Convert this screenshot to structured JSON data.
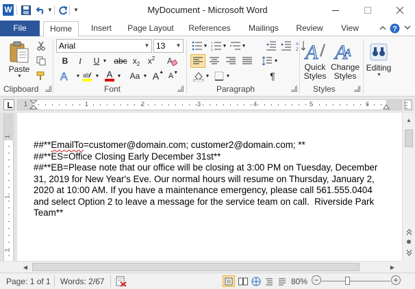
{
  "title": {
    "app_title": "MyDocument  -  Microsoft Word",
    "logo_letter": "W"
  },
  "tabs": {
    "file": "File",
    "items": [
      "Home",
      "Insert",
      "Page Layout",
      "References",
      "Mailings",
      "Review",
      "View"
    ],
    "active": "Home"
  },
  "ribbon": {
    "clipboard": {
      "label": "Clipboard",
      "paste": "Paste"
    },
    "font": {
      "label": "Font",
      "family": "Arial",
      "size": "13",
      "bold": "B",
      "italic": "I",
      "underline": "U",
      "strikethrough": "abc",
      "subscript": "x",
      "superscript": "x",
      "grow": "A",
      "shrink": "A",
      "case": "Aa",
      "color_letter": "A",
      "highlight_color": "#ffff00",
      "font_color": "#e00000"
    },
    "paragraph": {
      "label": "Paragraph",
      "show_marks": "¶"
    },
    "styles": {
      "label": "Styles",
      "quick": "Quick Styles",
      "change": "Change Styles"
    },
    "editing": {
      "label": "Editing"
    }
  },
  "ruler": {
    "numbers": [
      "1",
      "1",
      "2",
      "3",
      "4",
      "5",
      "6"
    ]
  },
  "vruler": {
    "numbers": [
      "1",
      "1",
      "2"
    ]
  },
  "document": {
    "lines": [
      {
        "prefix": "##**",
        "link": "EmailTo",
        "rest": "=customer@domain.com; customer2@domain.com; **"
      },
      {
        "text": "##**ES=Office Closing Early December 31st**"
      },
      {
        "text": "##**EB=Please note that our office will be closing at 3:00 PM on Tuesday, December 31, 2019 for New Year's Eve. Our normal hours will resume on Thursday, January 2, 2020 at 10:00 AM. If you have a maintenance emergency, please call 561.555.0404 and select Option 2 to leave a message for the service team on call.  Riverside Park Team**"
      }
    ]
  },
  "status": {
    "page": "Page: 1 of 1",
    "words": "Words: 2/67",
    "zoom": "80%",
    "zoom_fraction": 0.4,
    "minus": "−",
    "plus": "+"
  },
  "colors": {
    "file_tab": "#2b579a",
    "accent_active": "#fbe3a8"
  }
}
